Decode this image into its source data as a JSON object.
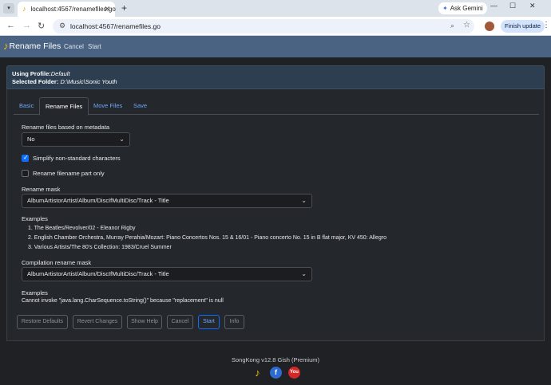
{
  "browser": {
    "tab_title": "localhost:4567/renamefiles.go",
    "url": "localhost:4567/renamefiles.go",
    "ask_gemini": "Ask Gemini",
    "finish_update": "Finish update"
  },
  "appnav": {
    "brand": "Rename Files",
    "cancel": "Cancel",
    "start": "Start"
  },
  "info": {
    "profile_label": "Using Profile:",
    "profile_value": "Default",
    "folder_label": "Selected Folder:",
    "folder_value": "D:\\Music\\Sonic Youth"
  },
  "tabs": [
    "Basic",
    "Rename Files",
    "Move Files",
    "Save"
  ],
  "form": {
    "metadata_label": "Rename files based on metadata",
    "metadata_value": "No",
    "simplify_label": "Simplify non-standard characters",
    "simplify_checked": true,
    "filename_part_label": "Rename filename part only",
    "filename_part_checked": false,
    "mask_label": "Rename mask",
    "mask_value": "AlbumArtistorArtist/Album/DiscIfMultiDisc/Track - Title",
    "examples_label": "Examples",
    "examples": [
      "1. The Beatles/Revolver/02 - Eleanor Rigby",
      "2. English Chamber Orchestra, Murray Perahia/Mozart: Piano Concertos Nos. 15 & 16/01 - Piano concerto No. 15 in B flat major, KV 450: Allegro",
      "3. Various Artists/The 80's Collection: 1983/Cruel Summer"
    ],
    "compilation_label": "Compilation rename mask",
    "compilation_value": "AlbumArtistorArtist/Album/DiscIfMultiDisc/Track - Title",
    "examples2_label": "Examples",
    "error_text": "Cannot invoke \"java.lang.CharSequence.toString()\" because \"replacement\" is null"
  },
  "buttons": {
    "restore": "Restore Defaults",
    "revert": "Revert Changes",
    "help": "Show Help",
    "cancel": "Cancel",
    "start": "Start",
    "info": "Info"
  },
  "footer": {
    "version": "SongKong v12.8 Gish (Premium)",
    "youtube_icon_text": "You"
  },
  "colors": {
    "navbar": "#4b6382",
    "accent": "#0d6efd",
    "background": "#202124"
  }
}
